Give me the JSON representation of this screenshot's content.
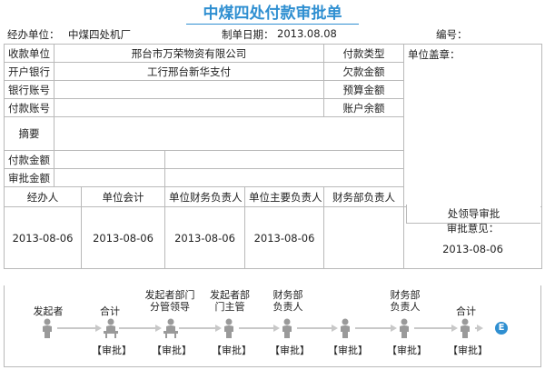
{
  "title": "中煤四处付款审批单",
  "meta": {
    "unit_label": "经办单位：",
    "unit_value": "中煤四处机厂",
    "date_label": "制单日期：",
    "date_value": "2013.08.08",
    "number_label": "编号："
  },
  "form": {
    "payee_label": "收款单位",
    "payee_value": "邢台市万荣物资有限公司",
    "payment_type_label": "付款类型",
    "seal_label": "单位盖章：",
    "bank_label": "开户银行",
    "bank_value": "工行邢台新华支付",
    "owed_label": "欠款金额",
    "account_label": "银行账号",
    "budget_label": "预算金额",
    "pay_account_label": "付款账号",
    "balance_label": "账户余额",
    "summary_label": "摘要",
    "pay_amount_label": "付款金额",
    "approved_amount_label": "审批金额"
  },
  "signatures": {
    "headers": [
      "经办人",
      "单位会计",
      "单位财务负责人",
      "单位主要负责人",
      "财务部负责人",
      "处领导审批"
    ],
    "dates": [
      "2013-08-06",
      "2013-08-06",
      "2013-08-06",
      "2013-08-06",
      "",
      "2013-08-06"
    ],
    "opinion_label": "审批意见："
  },
  "flow": {
    "nodes": [
      {
        "label": "发起者",
        "action": ""
      },
      {
        "label": "合计",
        "action": "【审批】"
      },
      {
        "label": "发起者部门分管领导",
        "action": "【审批】"
      },
      {
        "label": "发起者部门主管",
        "action": "【审批】"
      },
      {
        "label": "财务部负责人",
        "action": "【审批】"
      },
      {
        "label": "",
        "action": "【审批】"
      },
      {
        "label": "财务部负责人",
        "action": "【审批】"
      },
      {
        "label": "合计",
        "action": "【审批】"
      }
    ],
    "end_symbol": "E"
  }
}
